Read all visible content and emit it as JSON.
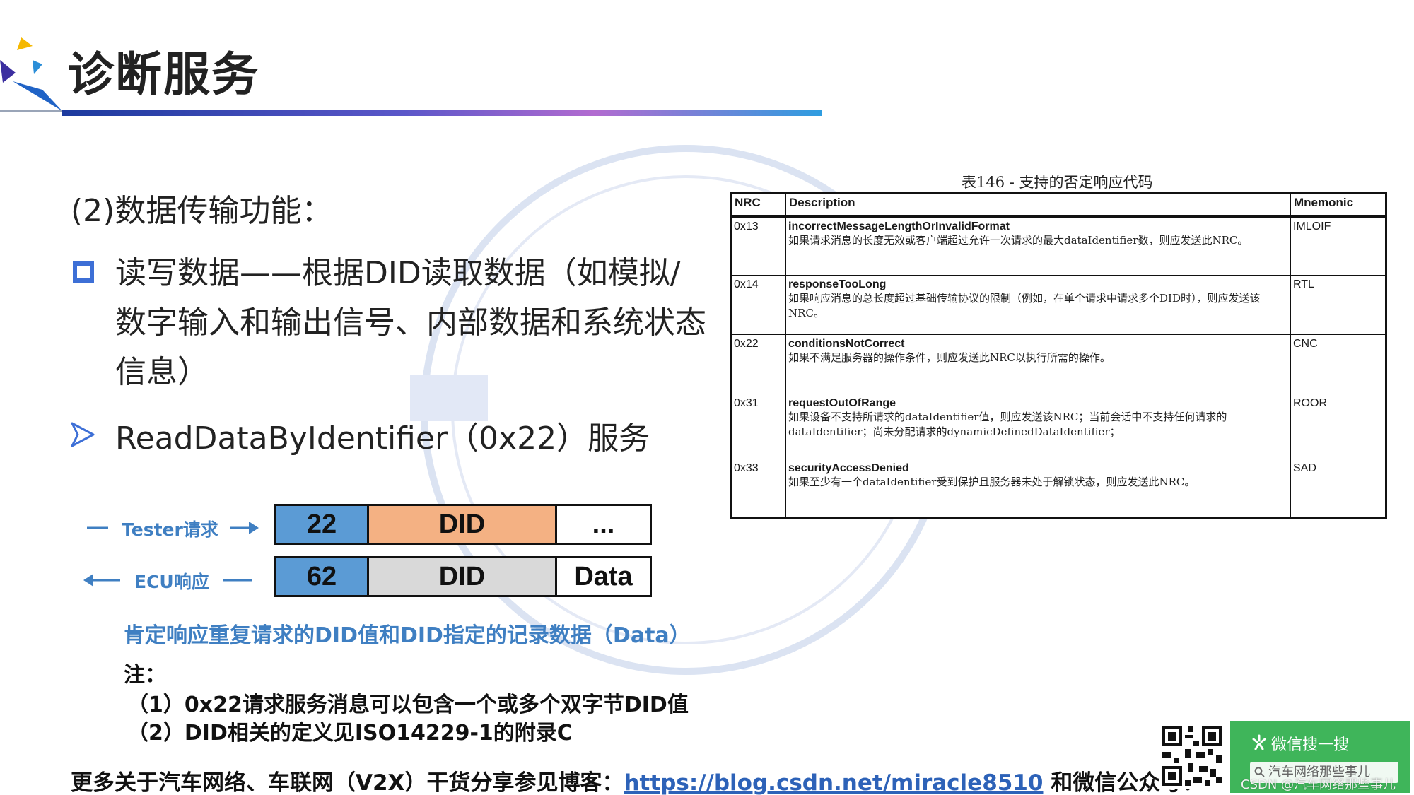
{
  "header": {
    "title": "诊断服务"
  },
  "content": {
    "section_heading": "(2)数据传输功能：",
    "bullet_text": "读写数据——根据DID读取数据（如模拟/数字输入和输出信号、内部数据和系统状态信息）",
    "service_text": "ReadDataByIdentifier（0x22）服务"
  },
  "frames": {
    "request": {
      "label": "Tester请求",
      "cells": [
        "22",
        "DID",
        "..."
      ]
    },
    "response": {
      "label": "ECU响应",
      "cells": [
        "62",
        "DID",
        "Data"
      ]
    },
    "positive_note": "肯定响应重复请求的DID值和DID指定的记录数据（Data）",
    "note_label": "注：",
    "notes": [
      "（1）0x22请求服务消息可以包含一个或多个双字节DID值",
      "（2）DID相关的定义见ISO14229-1的附录C"
    ]
  },
  "nrc_table": {
    "caption": "表146 - 支持的否定响应代码",
    "headers": [
      "NRC",
      "Description",
      "Mnemonic"
    ],
    "rows": [
      {
        "code": "0x13",
        "name": "incorrectMessageLengthOrInvalidFormat",
        "desc": "如果请求消息的长度无效或客户端超过允许一次请求的最大dataIdentifier数，则应发送此NRC。",
        "mnemonic": "IMLOIF"
      },
      {
        "code": "0x14",
        "name": "responseTooLong",
        "desc": "如果响应消息的总长度超过基础传输协议的限制（例如，在单个请求中请求多个DID时），则应发送该NRC。",
        "mnemonic": "RTL"
      },
      {
        "code": "0x22",
        "name": "conditionsNotCorrect",
        "desc": "如果不满足服务器的操作条件，则应发送此NRC以执行所需的操作。",
        "mnemonic": "CNC"
      },
      {
        "code": "0x31",
        "name": "requestOutOfRange",
        "desc": "如果设备不支持所请求的dataIdentifier值，则应发送该NRC；当前会话中不支持任何请求的dataIdentifier；尚未分配请求的dynamicDefinedDataIdentifier；",
        "mnemonic": "ROOR"
      },
      {
        "code": "0x33",
        "name": "securityAccessDenied",
        "desc": "如果至少有一个dataIdentifier受到保护且服务器未处于解锁状态，则应发送此NRC。",
        "mnemonic": "SAD"
      }
    ]
  },
  "footer": {
    "prefix": "更多关于汽车网络、车联网（V2X）干货分享参见博客：",
    "link": "https://blog.csdn.net/miracle8510",
    "suffix": " 和微信公众号："
  },
  "wechat": {
    "search_label": "微信搜一搜",
    "account": "汽车网络那些事儿",
    "credit": "CSDN @汽车网络那些事儿"
  },
  "colors": {
    "accent_blue": "#3d6fd6",
    "label_blue": "#3f7fc2",
    "sid_blue": "#5b9bd5",
    "did_orange": "#f4b183",
    "did_gray": "#d9d9d9",
    "wechat_green": "#3fb55a"
  }
}
